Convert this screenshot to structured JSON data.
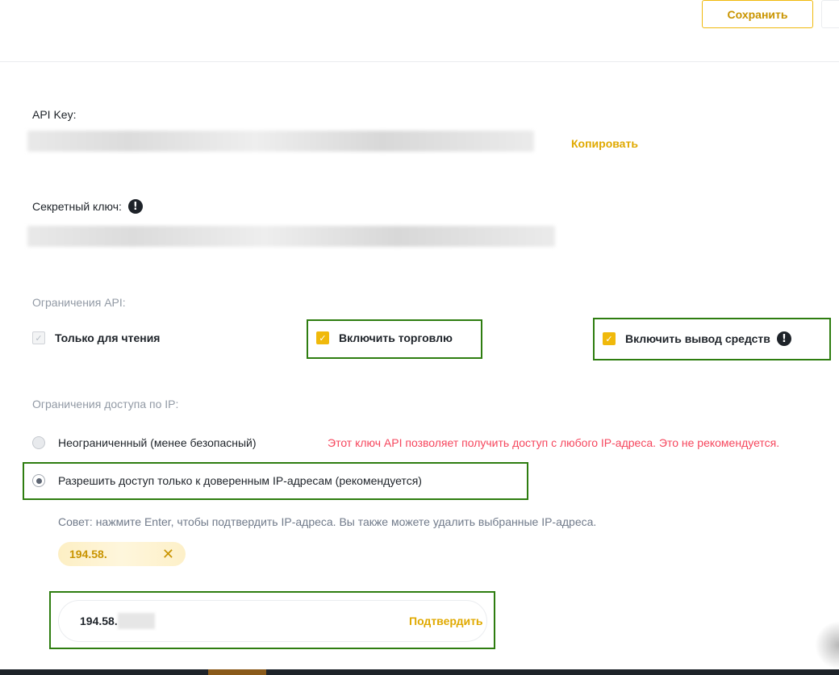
{
  "header": {
    "save_label": "Сохранить"
  },
  "api_key": {
    "label": "API Key:",
    "copy_label": "Копировать"
  },
  "secret_key": {
    "label": "Секретный ключ:"
  },
  "restrictions": {
    "title": "Ограничения API:",
    "read_only": {
      "label": "Только для чтения",
      "checked": true,
      "disabled": true
    },
    "enable_trading": {
      "label": "Включить торговлю",
      "checked": true
    },
    "enable_withdrawals": {
      "label": "Включить вывод средств",
      "checked": true
    }
  },
  "ip_access": {
    "title": "Ограничения доступа по IP:",
    "unrestricted": {
      "label": "Неограниченный (менее безопасный)",
      "selected": false
    },
    "warning": "Этот ключ API позволяет получить доступ с любого IP-адреса. Это не рекомендуется.",
    "trusted_only": {
      "label": "Разрешить доступ только к доверенным IP-адресам (рекомендуется)",
      "selected": true
    },
    "tip": "Совет: нажмите Enter, чтобы подтвердить IP-адреса. Вы также можете удалить выбранные IP-адреса.",
    "chip": {
      "value": "194.58.",
      "remove_glyph": "✕"
    },
    "input": {
      "value": "194.58.",
      "confirm_label": "Подтвердить"
    }
  },
  "colors": {
    "accent": "#f0b90b",
    "link": "#e0a900",
    "warning": "#f6465d",
    "highlight_border": "#2e7d10"
  },
  "icons": {
    "alert": "exclamation-circle-icon",
    "check": "check-icon",
    "close": "close-icon"
  }
}
